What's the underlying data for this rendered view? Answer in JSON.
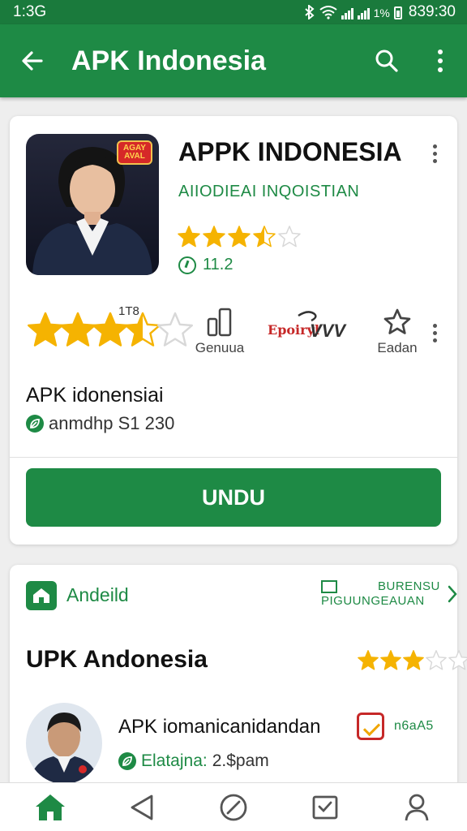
{
  "status_bar": {
    "time": "1:3G",
    "battery_text": "1%",
    "clock_right": "839:30"
  },
  "app_bar": {
    "title": "APK Indonesia"
  },
  "app": {
    "icon_badge": "AGAY AVAL",
    "title": "APPK INDONESIA",
    "developer": "AIIODIEAI INQOISTIAN",
    "small_rating": 3.5,
    "version": "11.2",
    "big_rating": 3.5,
    "rating_count": "1T8",
    "size_label": "Genuua",
    "brand_logo_text": "Epoiryl",
    "brand_logo_mark": "VVV",
    "favorite_label": "Eadan",
    "info_name": "APK idonensiai",
    "info_meta": "anmdhp S1 230",
    "install_button": "UNDU"
  },
  "section": {
    "category_label": "Andeild",
    "more_line1": "BURENSU",
    "more_line2": "PIGUUNGEAUAN",
    "title": "UPK Andonesia",
    "rating": 3,
    "list_item": {
      "title": "APK iomanicanidandan",
      "meta_label": "Elatajna:",
      "meta_value": "2.$pam",
      "offer_text": "n6aA5"
    }
  },
  "bottom_nav": [
    "home-tab",
    "back-tab",
    "explore-tab",
    "inbox-tab",
    "profile-tab"
  ],
  "colors": {
    "brand_green": "#1e8a45",
    "status_green": "#1a7a3c",
    "star": "#f5b301",
    "badge_red": "#d62828"
  }
}
